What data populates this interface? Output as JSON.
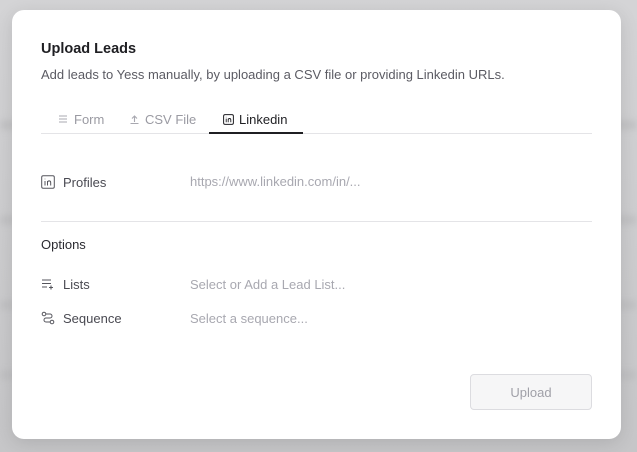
{
  "modal": {
    "title": "Upload Leads",
    "subtitle": "Add leads to Yess manually, by uploading a CSV file or providing Linkedin URLs."
  },
  "tabs": [
    {
      "label": "Form",
      "icon": "form-list-icon",
      "active": false
    },
    {
      "label": "CSV File",
      "icon": "upload-icon",
      "active": false
    },
    {
      "label": "Linkedin",
      "icon": "linkedin-icon",
      "active": true
    }
  ],
  "profiles": {
    "label": "Profiles",
    "icon": "linkedin-icon",
    "placeholder": "https://www.linkedin.com/in/..."
  },
  "options": {
    "title": "Options",
    "lists": {
      "label": "Lists",
      "icon": "list-add-icon",
      "placeholder": "Select or Add a Lead List..."
    },
    "sequence": {
      "label": "Sequence",
      "icon": "sequence-icon",
      "placeholder": "Select a sequence..."
    }
  },
  "actions": {
    "upload_label": "Upload"
  },
  "colors": {
    "text_primary": "#1f1f23",
    "text_muted": "#a8a8b0",
    "border": "#e4e4e7",
    "button_disabled_bg": "#f6f6f7"
  }
}
